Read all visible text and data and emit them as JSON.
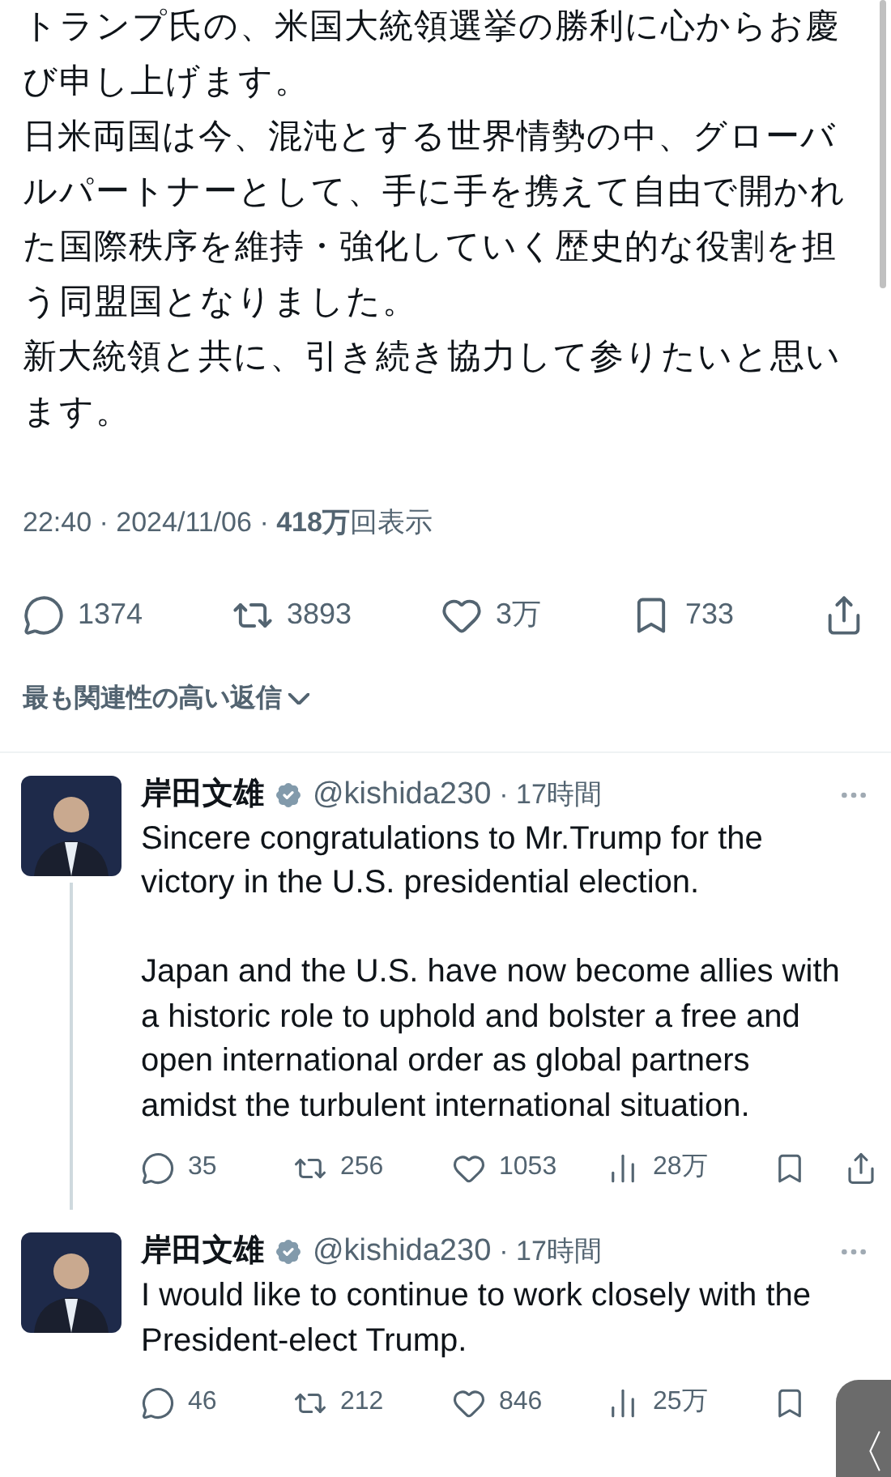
{
  "post": {
    "paragraphs": [
      "トランプ氏の、米国大統領選挙の勝利に心からお慶び申し上げます。",
      "日米両国は今、混沌とする世界情勢の中、グローバルパートナーとして、手に手を携えて自由で開かれた国際秩序を維持・強化していく歴史的な役割を担う同盟国となりました。",
      "新大統領と共に、引き続き協力して参りたいと思います。"
    ],
    "meta": "22:40 · 2024/11/06 · **418万**回表示",
    "stats": [
      {
        "kind": "reply",
        "count": "1374"
      },
      {
        "kind": "retweet",
        "count": "3893"
      },
      {
        "kind": "like",
        "count": "3万"
      },
      {
        "kind": "bookmark",
        "count": "733"
      },
      {
        "kind": "share"
      }
    ]
  },
  "sort_menu": {
    "label": "最も関連性の高い返信"
  },
  "replies": [
    {
      "name": "岸田文雄",
      "verified": true,
      "handle": "@kishida230",
      "time": "· 17時間",
      "paragraphs": [
        "Sincere congratulations to Mr.Trump for the victory in the U.S. presidential election.",
        "Japan and the U.S. have now become allies with a historic role to uphold and bolster a free and open international order as global partners amidst the turbulent international situation."
      ],
      "thread_continues": true,
      "stats": [
        {
          "kind": "reply",
          "count": "35"
        },
        {
          "kind": "retweet",
          "count": "256"
        },
        {
          "kind": "like",
          "count": "1053"
        },
        {
          "kind": "views",
          "count": "28万"
        },
        {
          "kind": "bookmark"
        },
        {
          "kind": "share"
        }
      ]
    },
    {
      "name": "岸田文雄",
      "verified": true,
      "handle": "@kishida230",
      "time": "· 17時間",
      "paragraphs": [
        "I would like to continue to work closely with the President-elect Trump."
      ],
      "thread_continues": false,
      "stats": [
        {
          "kind": "reply",
          "count": "46"
        },
        {
          "kind": "retweet",
          "count": "212"
        },
        {
          "kind": "like",
          "count": "846"
        },
        {
          "kind": "views",
          "count": "25万"
        },
        {
          "kind": "bookmark"
        }
      ]
    }
  ],
  "back_handle": {
    "label": "〈"
  }
}
